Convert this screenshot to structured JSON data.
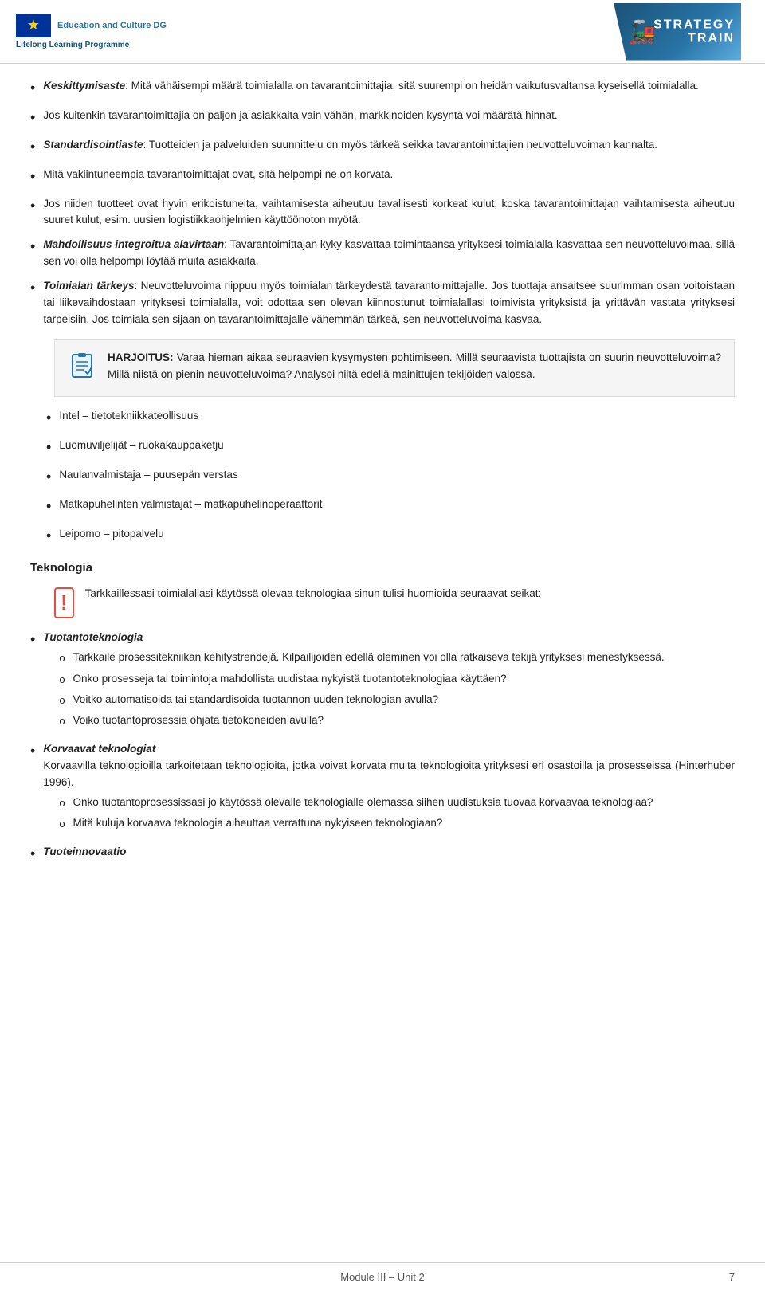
{
  "header": {
    "eu_line1": "Education and Culture DG",
    "lifelong": "Lifelong Learning Programme",
    "strategy_title_line1": "STRATEGY",
    "strategy_title_line2": "TRAIN"
  },
  "content": {
    "bullet1": {
      "label": "Keskittymisaste",
      "text": ": Mitä vähäisempi määrä toimialalla on tavarantoimittajia, sitä suurempi on heidän vaikutusvaltansa kyseisellä toimialalla."
    },
    "bullet2": {
      "text": "Jos kuitenkin tavarantoimittajia on paljon ja asiakkaita vain vähän, markkinoiden kysyntä voi määrätä hinnat."
    },
    "bullet3": {
      "label": "Standardisointiaste",
      "text": ": Tuotteiden ja palveluiden suunnittelu on myös tärkeä seikka tavarantoimittajien neuvotteluvoiman kannalta."
    },
    "bullet4": {
      "text": "Mitä vakiintuneempia tavarantoimittajat ovat, sitä helpompi ne on korvata."
    },
    "bullet5": {
      "text": "Jos niiden tuotteet ovat hyvin erikoistuneita, vaihtamisesta aiheutuu tavallisesti korkeat kulut, koska tavarantoimittajan vaihtamisesta aiheutuu suuret kulut, esim. uusien logistiikkaohjelmien käyttöönoton myötä."
    },
    "bullet6": {
      "label": "Mahdollisuus integroitua alavirtaan",
      "text": ": Tavarantoimittajan kyky kasvattaa toimintaansa yrityksesi toimialalla kasvattaa sen neuvotteluvoimaa, sillä sen voi olla helpompi löytää muita asiakkaita."
    },
    "bullet7": {
      "label": "Toimialan tärkeys",
      "text": ": Neuvotteluvoima riippuu myös toimialan tärkeydestä tavarantoimittajalle. Jos tuottaja ansaitsee suurimman osan voitoistaan tai liikevaihdostaan yrityksesi toimialalla, voit odottaa sen olevan kiinnostunut toimialallasi toimivista yrityksistä ja yrittävän vastata yrityksesi tarpeisiin. Jos toimiala sen sijaan on tavarantoimittajalle vähemmän tärkeä, sen neuvotteluvoima kasvaa."
    },
    "exercise": {
      "prefix": "HARJOITUS:",
      "text": " Varaa hieman aikaa seuraavien kysymysten pohtimiseen. Millä seuraavista tuottajista on suurin neuvotteluvoima? Millä niistä on pienin neuvotteluvoima? Analysoi niitä edellä mainittujen tekijöiden valossa."
    },
    "list_items": [
      "Intel – tietotekniikkateollisuus",
      "Luomuviljelijät – ruokakauppaketju",
      "Naulanvalmistaja – puusepän verstas",
      "Matkapuhelinten valmistajat – matkapuhelinoperaattorit",
      "Leipomo – pitopalvelu"
    ],
    "teknologia_heading": "Teknologia",
    "attention_text": "Tarkkaillessasi toimialallasi käytössä olevaa teknologiaa sinun tulisi huomioida seuraavat seikat:",
    "tuotantoteknologia_label": "Tuotantoteknologia",
    "sub_items_tuotanto": [
      "Tarkkaile prosessitekniikan kehitystrendejä. Kilpailijoiden edellä oleminen voi olla ratkaiseva tekijä yrityksesi menestyksessä.",
      "Onko prosesseja tai toimintoja mahdollista uudistaa nykyistä tuotantoteknologiaa käyttäen?",
      "Voitko automatisoida tai standardisoida tuotannon uuden teknologian avulla?",
      "Voiko tuotantoprosessia ohjata tietokoneiden avulla?"
    ],
    "korvaavat_label": "Korvaavat teknologiat",
    "korvaavat_text": "Korvaavilla teknologioilla tarkoitetaan teknologioita, jotka voivat korvata muita teknologioita yrityksesi eri osastoilla ja prosesseissa (Hinterhuber 1996).",
    "sub_items_korvaavat": [
      "Onko tuotantoprosessissasi jo käytössä olevalle teknologialle olemassa siihen uudistuksia tuovaa korvaavaa teknologiaa?",
      "Mitä kuluja korvaava teknologia aiheuttaa verrattuna nykyiseen teknologiaan?"
    ],
    "tuoteinnovaatio_label": "Tuoteinnovaatio"
  },
  "footer": {
    "center": "Module III – Unit 2",
    "page": "7"
  }
}
